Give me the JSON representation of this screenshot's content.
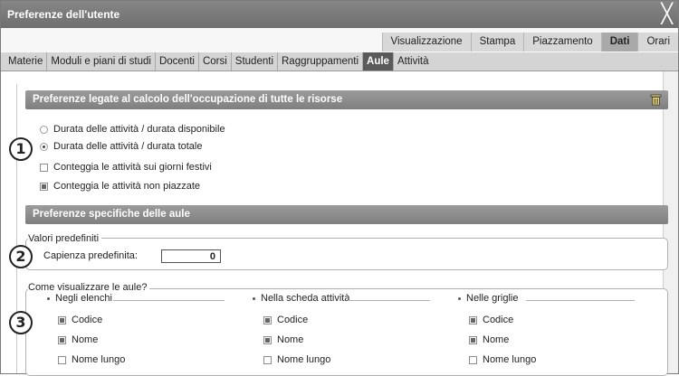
{
  "window": {
    "title": "Preferenze dell'utente",
    "close_glyph": "╳"
  },
  "top_tabs": [
    {
      "label": "Visualizzazione",
      "active": false
    },
    {
      "label": "Stampa",
      "active": false
    },
    {
      "label": "Piazzamento",
      "active": false
    },
    {
      "label": "Dati",
      "active": true
    },
    {
      "label": "Orari",
      "active": false
    }
  ],
  "sub_tabs": [
    {
      "label": "Materie",
      "active": false
    },
    {
      "label": "Moduli e piani di studi",
      "active": false
    },
    {
      "label": "Docenti",
      "active": false
    },
    {
      "label": "Corsi",
      "active": false
    },
    {
      "label": "Studenti",
      "active": false
    },
    {
      "label": "Raggruppamenti",
      "active": false
    },
    {
      "label": "Aule",
      "active": true
    },
    {
      "label": "Attività",
      "active": false
    }
  ],
  "section1": {
    "title": "Preferenze legate al calcolo dell'occupazione di tutte le risorse",
    "icon": "trash-icon",
    "radio_available": "Durata delle attività / durata disponibile",
    "radio_total": "Durata delle attività / durata totale",
    "check_holidays": "Conteggia le attività sui giorni festivi",
    "check_unplaced": "Conteggia le attività non piazzate",
    "selected_radio": "total",
    "holidays_checked": false,
    "unplaced_checked": true
  },
  "section2": {
    "title": "Preferenze specifiche delle aule",
    "defaults_legend": "Valori predefiniti",
    "capacity_label": "Capienza predefinita:",
    "capacity_value": "0",
    "display_legend": "Come visualizzare le aule?",
    "columns": [
      {
        "title": "Negli elenchi",
        "items": [
          {
            "label": "Codice",
            "checked": true
          },
          {
            "label": "Nome",
            "checked": true
          },
          {
            "label": "Nome lungo",
            "checked": false
          }
        ]
      },
      {
        "title": "Nella scheda attività",
        "items": [
          {
            "label": "Codice",
            "checked": true
          },
          {
            "label": "Nome",
            "checked": true
          },
          {
            "label": "Nome lungo",
            "checked": false
          }
        ]
      },
      {
        "title": "Nelle griglie",
        "items": [
          {
            "label": "Codice",
            "checked": true
          },
          {
            "label": "Nome",
            "checked": true
          },
          {
            "label": "Nome lungo",
            "checked": false
          }
        ]
      }
    ]
  },
  "badges": [
    "1",
    "2",
    "3"
  ]
}
